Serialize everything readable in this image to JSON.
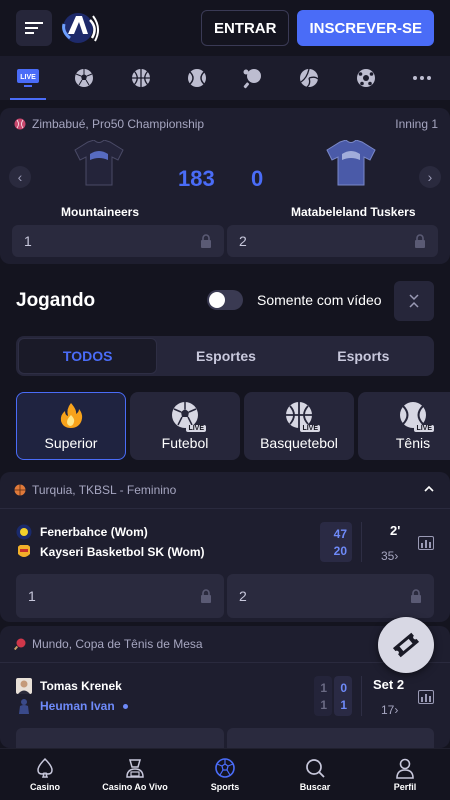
{
  "header": {
    "login_label": "ENTRAR",
    "signup_label": "INSCREVER-SE",
    "accent": "#4a6cf7"
  },
  "sportbar": {
    "live_label": "LIVE",
    "items": [
      "live-tv-icon",
      "soccer-icon",
      "basketball-icon",
      "tennis-icon",
      "table-tennis-icon",
      "volleyball-icon",
      "futsal-icon",
      "more-icon"
    ]
  },
  "featured": {
    "league": "Zimbabué, Pro50 Championship",
    "inning": "Inning 1",
    "home_team": "Mountaineers",
    "away_team": "Matabeleland Tuskers",
    "home_score": "183",
    "away_score": "0",
    "odd1_label": "1",
    "odd2_label": "2"
  },
  "jogando": {
    "title": "Jogando",
    "video_toggle_label": "Somente com vídeo"
  },
  "tabs": [
    "TODOS",
    "Esportes",
    "Esports"
  ],
  "categories": [
    {
      "label": "Superior",
      "icon": "fire-icon"
    },
    {
      "label": "Futebol",
      "icon": "soccer-icon",
      "live": "LIVE"
    },
    {
      "label": "Basquetebol",
      "icon": "basketball-icon",
      "live": "LIVE"
    },
    {
      "label": "Tênis",
      "icon": "tennis-icon",
      "live": "LIVE"
    }
  ],
  "match1": {
    "league": "Turquia, TKBSL - Feminino",
    "home": "Fenerbahce (Wom)",
    "away": "Kayseri Basketbol SK (Wom)",
    "home_score": "47",
    "away_score": "20",
    "period": "2'",
    "more": "35",
    "odd1_label": "1",
    "odd2_label": "2"
  },
  "match2": {
    "league": "Mundo, Copa de Tênis de Mesa",
    "home": "Tomas Krenek",
    "away": "Heuman Ivan",
    "home_prev": "1",
    "home_score": "0",
    "away_prev": "1",
    "away_score": "1",
    "period": "Set 2",
    "more": "17"
  },
  "bottom_nav": [
    {
      "label": "Casino",
      "icon": "spade-icon"
    },
    {
      "label": "Casino Ao Vivo",
      "icon": "dealer-icon"
    },
    {
      "label": "Sports",
      "icon": "soccer-ball-icon",
      "active": true
    },
    {
      "label": "Buscar",
      "icon": "search-icon"
    },
    {
      "label": "Perfil",
      "icon": "profile-icon"
    }
  ]
}
